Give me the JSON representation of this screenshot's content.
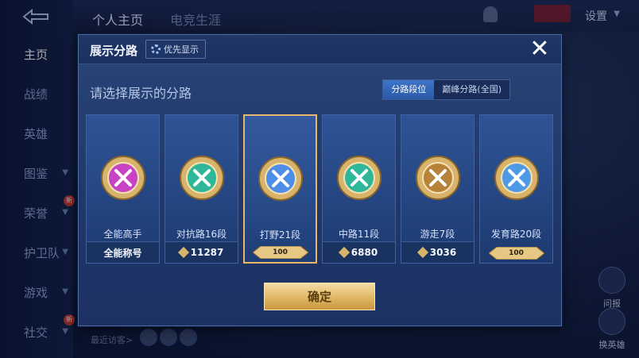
{
  "background": {
    "top_tabs": [
      "个人主页",
      "电竞生涯"
    ],
    "settings_label": "设置",
    "nav_items": [
      {
        "label": "主页",
        "has_new": false,
        "has_chevron": false
      },
      {
        "label": "战绩",
        "has_new": false,
        "has_chevron": false
      },
      {
        "label": "英雄",
        "has_new": false,
        "has_chevron": false
      },
      {
        "label": "图鉴",
        "has_new": false,
        "has_chevron": true
      },
      {
        "label": "荣誉",
        "has_new": true,
        "has_chevron": true
      },
      {
        "label": "护卫队",
        "has_new": false,
        "has_chevron": true
      },
      {
        "label": "游戏",
        "has_new": false,
        "has_chevron": true
      },
      {
        "label": "社交",
        "has_new": true,
        "has_chevron": true
      }
    ],
    "new_badge": "新",
    "recent_visitors_label": "最近访客>",
    "right_widgets": [
      "问报",
      "换英雄"
    ]
  },
  "dialog": {
    "title": "展示分路",
    "priority_button_label": "优先显示",
    "close_icon": "close-icon",
    "prompt": "请选择展示的分路",
    "segments": [
      {
        "label": "分路段位",
        "active": true
      },
      {
        "label": "巅峰分路(全国)",
        "active": false
      }
    ],
    "cards": [
      {
        "name": "全能高手",
        "stat_label": "全能称号",
        "stat_value": "",
        "banner": "",
        "emblem_color": "#c844c4",
        "selected": false
      },
      {
        "name": "对抗路16段",
        "stat_label": "",
        "stat_value": "11287",
        "banner": "",
        "emblem_color": "#2fb79a",
        "selected": false
      },
      {
        "name": "打野21段",
        "stat_label": "",
        "stat_value": "",
        "banner": "100",
        "emblem_color": "#4f8ee8",
        "selected": true
      },
      {
        "name": "中路11段",
        "stat_label": "",
        "stat_value": "6880",
        "banner": "",
        "emblem_color": "#2fb79a",
        "selected": false
      },
      {
        "name": "游走7段",
        "stat_label": "",
        "stat_value": "3036",
        "banner": "",
        "emblem_color": "#b7823a",
        "selected": false
      },
      {
        "name": "发育路20段",
        "stat_label": "",
        "stat_value": "",
        "banner": "100",
        "emblem_color": "#4f9ae6",
        "selected": false
      }
    ],
    "confirm_label": "确定"
  },
  "colors": {
    "accent_gold": "#e8b66a",
    "segment_active": "#3e74c9"
  }
}
